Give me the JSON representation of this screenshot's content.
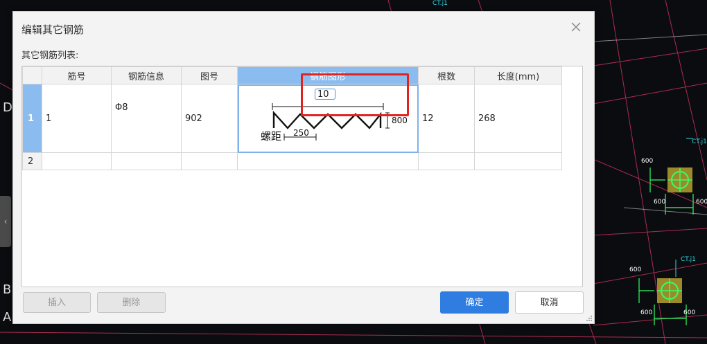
{
  "background": {
    "axis_labels": [
      "D",
      "B",
      "A"
    ],
    "green_dims": [
      "600",
      "600",
      "600",
      "600",
      "600",
      "600"
    ],
    "cyan_tags": [
      "CT.j1",
      "CT.j1",
      "CT.j1"
    ]
  },
  "dialog": {
    "title": "编辑其它钢筋",
    "list_label": "其它钢筋列表:",
    "columns": [
      "筋号",
      "钢筋信息",
      "图号",
      "钢筋图形",
      "根数",
      "长度(mm)"
    ],
    "rows": [
      {
        "num": "1",
        "bar_no": "1",
        "info": "Φ8",
        "fig_no": "902",
        "count": "12",
        "length": "268"
      },
      {
        "num": "2",
        "bar_no": "",
        "info": "",
        "fig_no": "",
        "count": "",
        "length": ""
      }
    ],
    "shape": {
      "input_value": "10",
      "height_dim": "800",
      "pitch_dim": "250",
      "pitch_label": "螺距"
    },
    "buttons": {
      "insert": "插入",
      "delete": "删除",
      "ok": "确定",
      "cancel": "取消"
    },
    "colors": {
      "accent": "#2f7de1",
      "active_header": "#8bbcf0",
      "highlight": "#e0231e"
    }
  }
}
